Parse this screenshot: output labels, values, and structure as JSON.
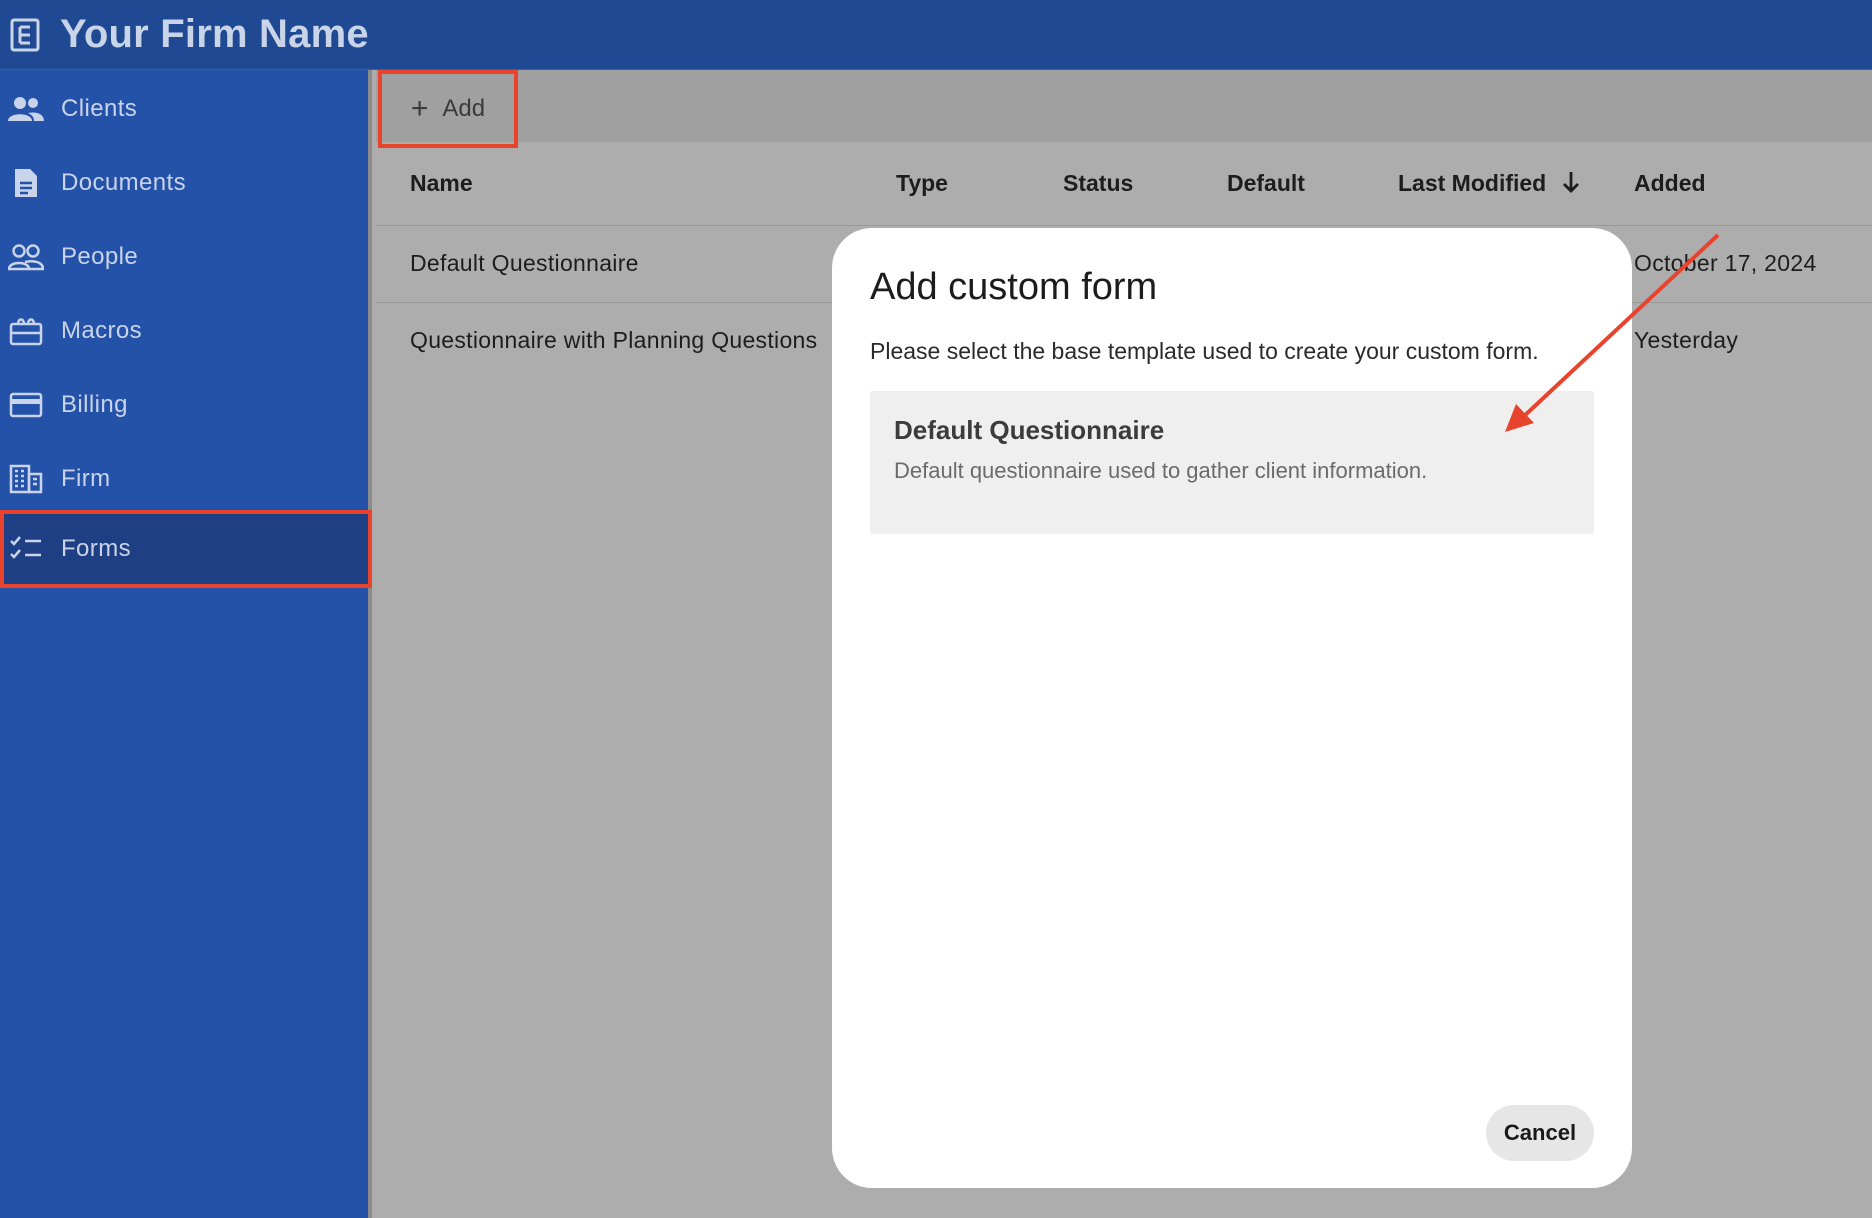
{
  "header": {
    "firm_name": "Your Firm Name",
    "logo_icon": "document-list-icon"
  },
  "sidebar": {
    "items": [
      {
        "label": "Clients",
        "icon": "people-icon"
      },
      {
        "label": "Documents",
        "icon": "document-icon"
      },
      {
        "label": "People",
        "icon": "people-outline-icon"
      },
      {
        "label": "Macros",
        "icon": "macro-icon"
      },
      {
        "label": "Billing",
        "icon": "credit-card-icon"
      },
      {
        "label": "Firm",
        "icon": "building-icon"
      },
      {
        "label": "Forms",
        "icon": "checklist-icon",
        "active": true
      }
    ]
  },
  "toolbar": {
    "add_label": "Add"
  },
  "table": {
    "columns": [
      "Name",
      "Type",
      "Status",
      "Default",
      "Last Modified",
      "Added"
    ],
    "sort_column": "Last Modified",
    "rows": [
      {
        "name": "Default Questionnaire",
        "added": "October 17, 2024"
      },
      {
        "name": "Questionnaire with Planning Questions",
        "added": "Yesterday"
      }
    ]
  },
  "modal": {
    "title": "Add custom form",
    "description": "Please select the base template used to create your custom form.",
    "templates": [
      {
        "title": "Default Questionnaire",
        "description": "Default questionnaire used to gather client information."
      }
    ],
    "cancel_label": "Cancel"
  },
  "colors": {
    "header_bg": "#1f4a93",
    "sidebar_bg": "#2452a8",
    "sidebar_active_bg": "#1e3f83",
    "highlight_red": "#e8432c",
    "overlay_gray": "#adadad"
  }
}
